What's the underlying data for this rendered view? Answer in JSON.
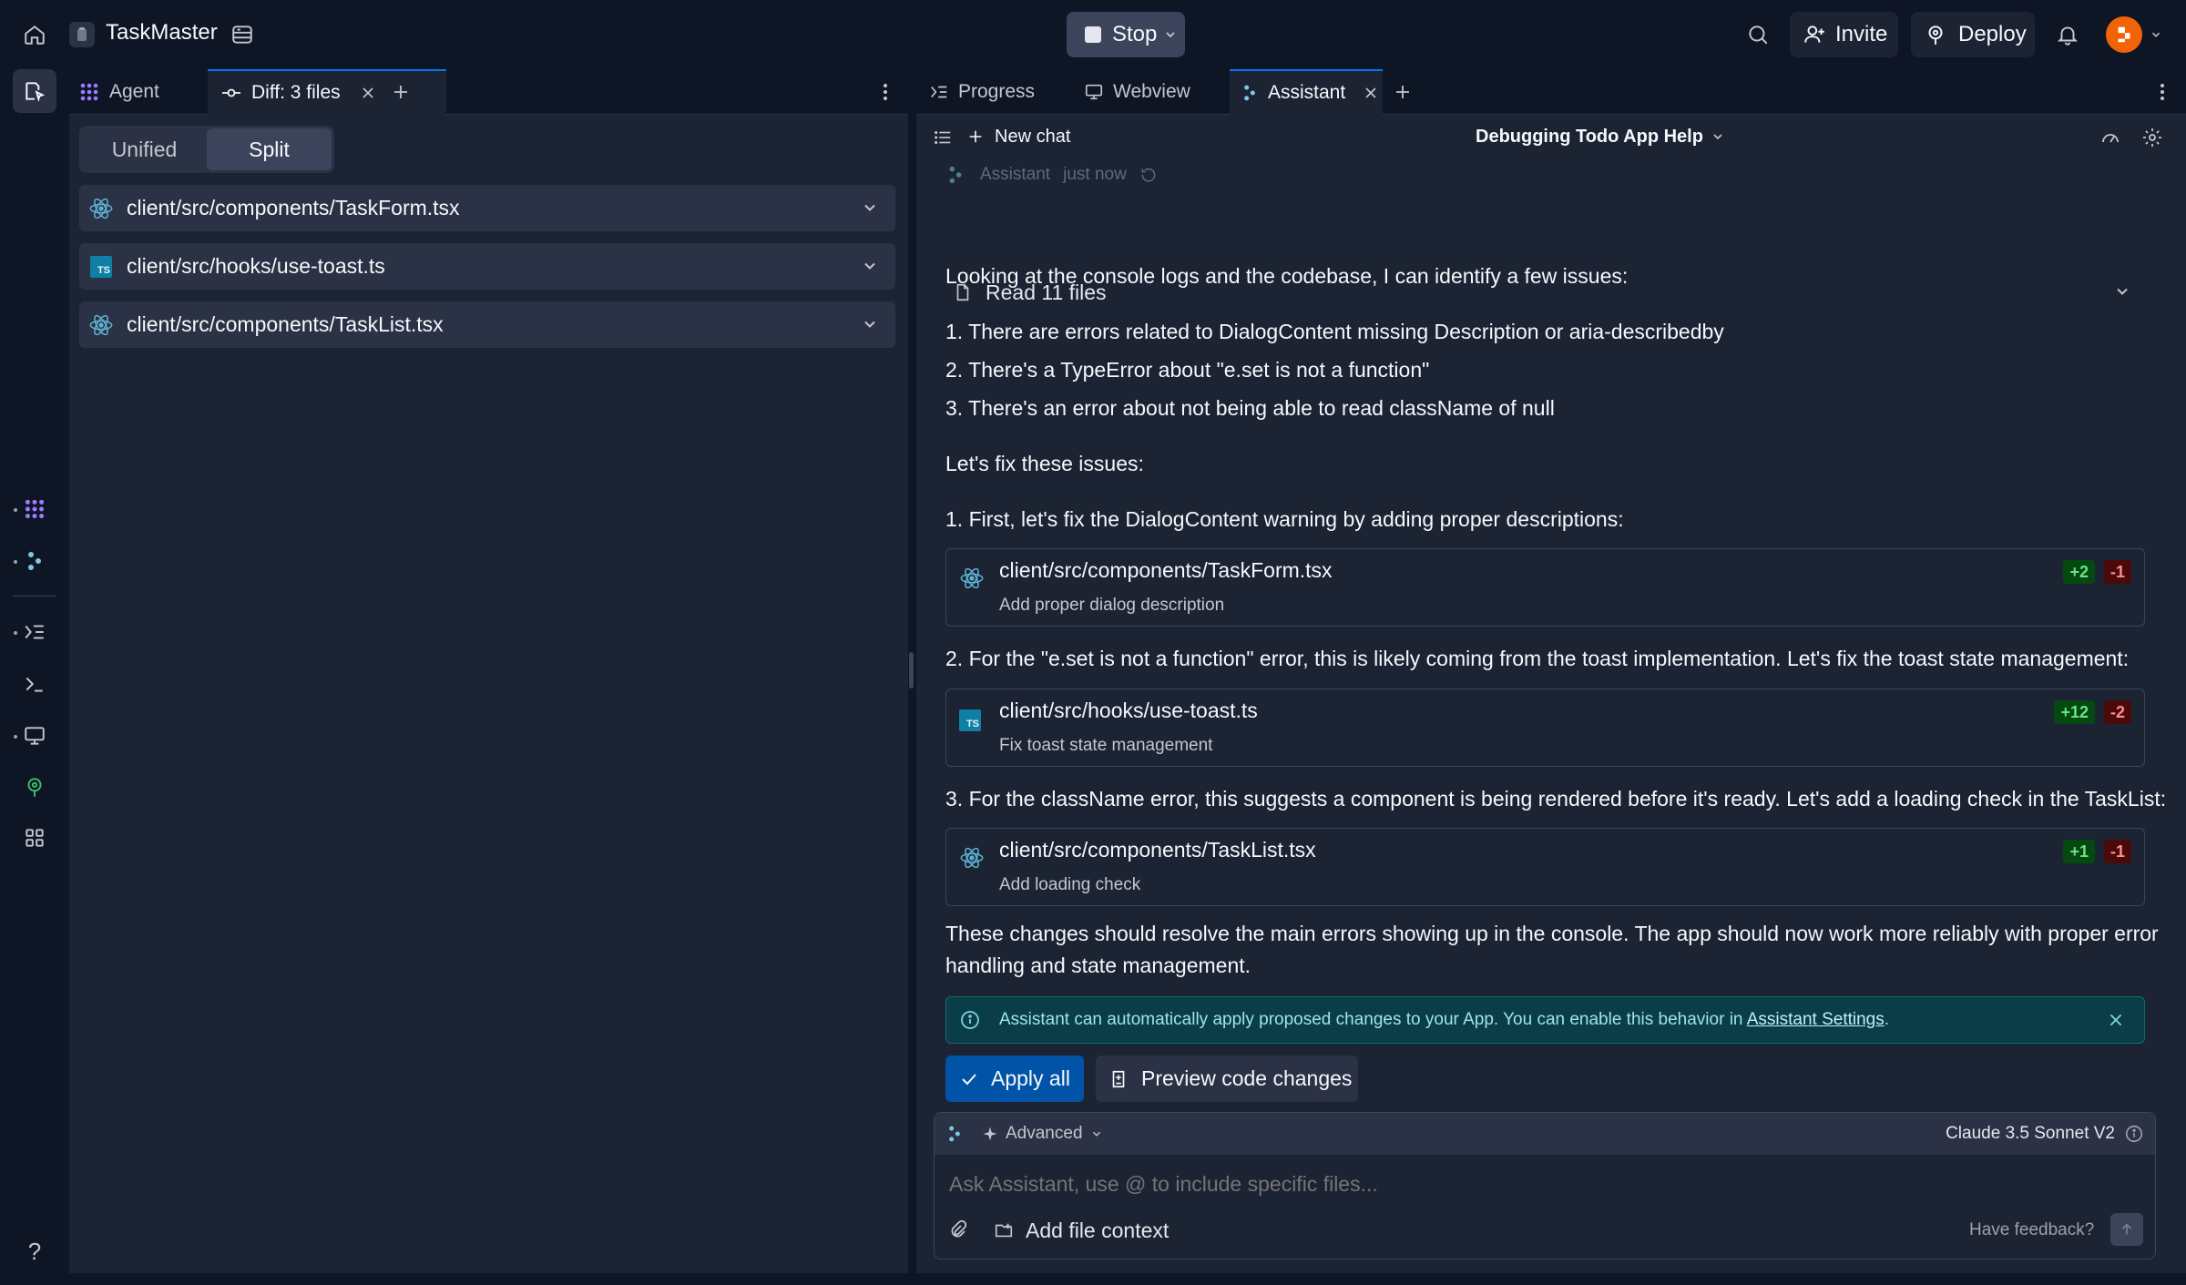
{
  "topbar": {
    "app_name": "TaskMaster",
    "stop_label": "Stop",
    "invite_label": "Invite",
    "deploy_label": "Deploy"
  },
  "left_panel": {
    "tabs": [
      {
        "label": "Agent"
      },
      {
        "label": "Diff: 3 files"
      }
    ],
    "view_modes": [
      "Unified",
      "Split"
    ],
    "selected_view": "Split",
    "files": [
      {
        "path": "client/src/components/TaskForm.tsx",
        "icon": "react-icon"
      },
      {
        "path": "client/src/hooks/use-toast.ts",
        "icon": "typescript-icon"
      },
      {
        "path": "client/src/components/TaskList.tsx",
        "icon": "react-icon"
      }
    ]
  },
  "right_panel": {
    "tabs": [
      {
        "label": "Progress"
      },
      {
        "label": "Webview"
      },
      {
        "label": "Assistant"
      }
    ],
    "new_chat_label": "New chat",
    "chat_title": "Debugging Todo App Help",
    "message": {
      "author": "Assistant",
      "time": "just now",
      "read_files": "Read 11 files",
      "intro": "Looking at the console logs and the codebase, I can identify a few issues:",
      "issues": [
        "1. There are errors related to DialogContent missing Description or aria-describedby",
        "2. There's a TypeError about \"e.set is not a function\"",
        "3. There's an error about not being able to read className of null"
      ],
      "lets_fix": "Let's fix these issues:",
      "step1": "1. First, let's fix the DialogContent warning by adding proper descriptions:",
      "step2": "2. For the \"e.set is not a function\" error, this is likely coming from the toast implementation. Let's fix the toast state management:",
      "step3": "3. For the className error, this suggests a component is being rendered before it's ready. Let's add a loading check in the TaskList:",
      "changes": [
        {
          "path": "client/src/components/TaskForm.tsx",
          "desc": "Add proper dialog description",
          "added": "+2",
          "removed": "-1",
          "icon": "react-icon"
        },
        {
          "path": "client/src/hooks/use-toast.ts",
          "desc": "Fix toast state management",
          "added": "+12",
          "removed": "-2",
          "icon": "typescript-icon"
        },
        {
          "path": "client/src/components/TaskList.tsx",
          "desc": "Add loading check",
          "added": "+1",
          "removed": "-1",
          "icon": "react-icon"
        }
      ],
      "conclusion_line1": "These changes should resolve the main errors showing up in the console. The app should now work more reliably with proper error",
      "conclusion_line2": "handling and state management."
    },
    "banner": {
      "text": "Assistant can automatically apply proposed changes to your App. You can enable this behavior in ",
      "link": "Assistant Settings",
      "suffix": "."
    },
    "apply_all_label": "Apply all",
    "preview_label": "Preview code changes",
    "composer": {
      "mode_label": "Advanced",
      "model_label": "Claude 3.5 Sonnet V2",
      "placeholder": "Ask Assistant, use @ to include specific files...",
      "add_context_label": "Add file context",
      "feedback_label": "Have feedback?"
    }
  },
  "help_label": "?",
  "colors": {
    "background": "#0e1525",
    "panel": "#1c2333",
    "accent": "#0079f2",
    "apply_button": "#0053a6",
    "banner": "#0a3d47",
    "added": "#6ee087",
    "removed": "#ff8c8c"
  }
}
